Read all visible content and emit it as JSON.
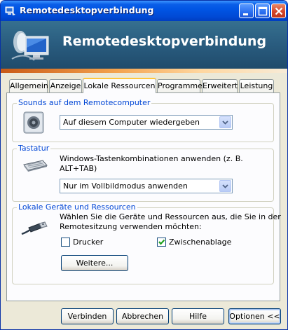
{
  "window": {
    "title": "Remotedesktopverbindung",
    "banner_title": "Remotedesktopverbindung"
  },
  "tabs": [
    {
      "label": "Allgemein",
      "active": false
    },
    {
      "label": "Anzeige",
      "active": false
    },
    {
      "label": "Lokale Ressourcen",
      "active": true
    },
    {
      "label": "Programme",
      "active": false
    },
    {
      "label": "Erweitert",
      "active": false
    },
    {
      "label": "Leistung",
      "active": false
    }
  ],
  "sounds": {
    "group_title": "Sounds auf dem Remotecomputer",
    "selected": "Auf diesem Computer wiedergeben"
  },
  "keyboard": {
    "group_title": "Tastatur",
    "description_line1": "Windows-Tastenkombinationen anwenden (z. B.",
    "description_line2": "ALT+TAB)",
    "selected": "Nur im Vollbildmodus anwenden"
  },
  "devices": {
    "group_title": "Lokale Geräte und Ressourcen",
    "description_line1": "Wählen Sie die Geräte und Ressourcen aus, die Sie in der",
    "description_line2": "Remotesitzung verwenden möchten:",
    "printer_label": "Drucker",
    "printer_checked": false,
    "clipboard_label": "Zwischenablage",
    "clipboard_checked": true,
    "more_button": "Weitere..."
  },
  "footer": {
    "connect": "Verbinden",
    "cancel": "Abbrechen",
    "help": "Hilfe",
    "options": "Optionen <<"
  },
  "colors": {
    "titlebar_blue": "#0054e3",
    "group_title_blue": "#0046d5",
    "tab_highlight": "#ffc73c",
    "checkmark_green": "#21a121"
  }
}
